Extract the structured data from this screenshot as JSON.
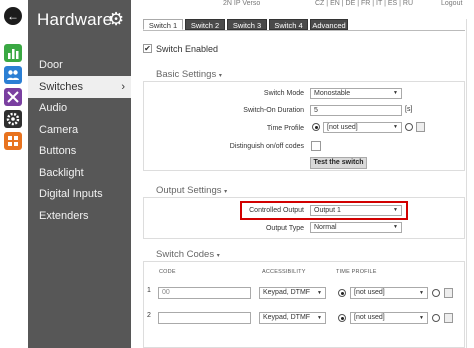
{
  "topbar": {
    "device": "2N IP Verso",
    "languages": [
      "CZ",
      "EN",
      "DE",
      "FR",
      "IT",
      "ES",
      "RU"
    ],
    "logout": "Logout"
  },
  "iconbar": {
    "tiles": [
      {
        "name": "stats-icon",
        "color": "#3aa843"
      },
      {
        "name": "users-icon",
        "color": "#2b7fd4"
      },
      {
        "name": "tools-icon",
        "color": "#7a3fa0"
      },
      {
        "name": "settings-icon",
        "color": "#2f2f2f"
      },
      {
        "name": "grid-icon",
        "color": "#e8731f"
      }
    ]
  },
  "sidebar": {
    "title": "Hardware",
    "items": [
      {
        "label": "Door"
      },
      {
        "label": "Switches",
        "active": true
      },
      {
        "label": "Audio"
      },
      {
        "label": "Camera"
      },
      {
        "label": "Buttons"
      },
      {
        "label": "Backlight"
      },
      {
        "label": "Digital Inputs"
      },
      {
        "label": "Extenders"
      }
    ]
  },
  "tabs": [
    {
      "label": "Switch 1",
      "active": true
    },
    {
      "label": "Switch 2"
    },
    {
      "label": "Switch 3"
    },
    {
      "label": "Switch 4"
    },
    {
      "label": "Advanced"
    }
  ],
  "main": {
    "switch_enabled_label": "Switch Enabled",
    "switch_enabled_checked": true,
    "basic": {
      "title": "Basic Settings",
      "switch_mode_label": "Switch Mode",
      "switch_mode_value": "Monostable",
      "switch_on_duration_label": "Switch-On Duration",
      "switch_on_duration_value": "5",
      "switch_on_duration_unit": "[s]",
      "time_profile_label": "Time Profile",
      "time_profile_value": "[not used]",
      "distinguish_label": "Distinguish on/off codes",
      "test_button": "Test the switch"
    },
    "output": {
      "title": "Output Settings",
      "controlled_output_label": "Controlled Output",
      "controlled_output_value": "Output 1",
      "output_type_label": "Output Type",
      "output_type_value": "Normal"
    },
    "codes": {
      "title": "Switch Codes",
      "columns": [
        "CODE",
        "ACCESSIBILITY",
        "TIME PROFILE"
      ],
      "rows": [
        {
          "num": "1",
          "code": "00",
          "code_is_placeholder": true,
          "accessibility": "Keypad, DTMF",
          "time_profile": "[not used]"
        },
        {
          "num": "2",
          "code": "",
          "accessibility": "Keypad, DTMF",
          "time_profile": "[not used]"
        }
      ]
    }
  },
  "colors": {
    "sidebar_bg": "#575757",
    "highlight": "#d20000",
    "tab_dark": "#4a4a4a"
  }
}
